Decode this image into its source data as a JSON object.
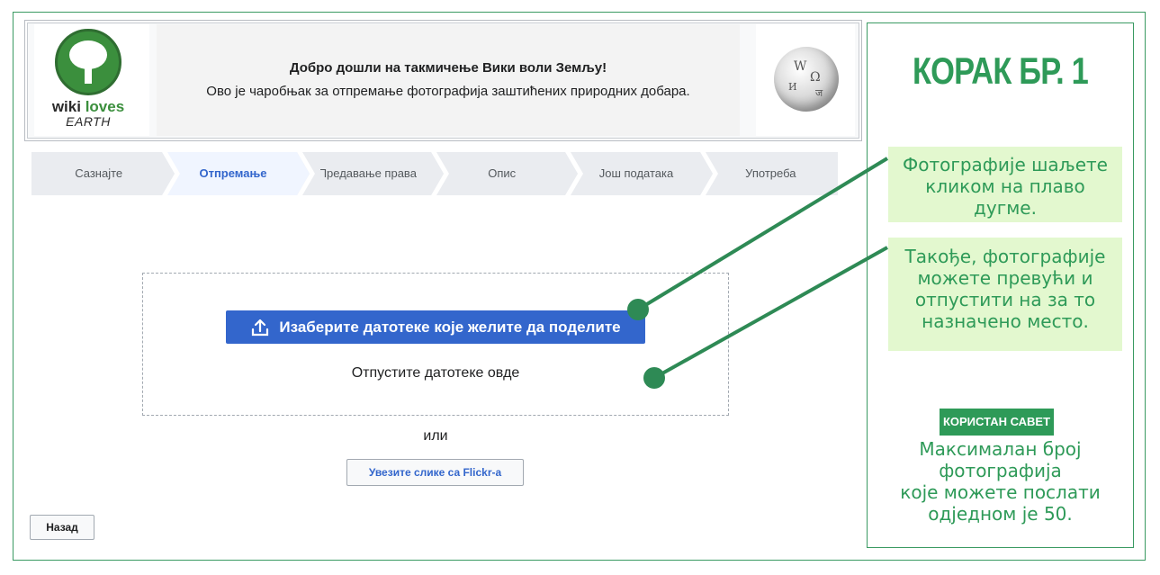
{
  "banner": {
    "logo_word_a": "wiki",
    "logo_word_b": "loves",
    "logo_word_c": "EARTH",
    "title": "Добро дошли на такмичење Вики воли Земљу!",
    "subtitle": "Ово је чаробњак за отпремање фотографија заштићених природних добара."
  },
  "steps": [
    {
      "label": "Сазнајте",
      "active": false
    },
    {
      "label": "Отпремање",
      "active": true
    },
    {
      "label": "Предавање права",
      "active": false
    },
    {
      "label": "Опис",
      "active": false
    },
    {
      "label": "Још података",
      "active": false
    },
    {
      "label": "Употреба",
      "active": false
    }
  ],
  "upload": {
    "button_label": "Изаберите датотеке које желите да поделите",
    "drop_text": "Отпустите датотеке овде",
    "or_text": "или",
    "flickr_button": "Увезите слике са Flickr-а"
  },
  "back_button": "Назад",
  "tutorial": {
    "step_title": "КОРАК БР. 1",
    "callout1": [
      "Фотографије шаљете",
      "кликом на плаво",
      "дугме."
    ],
    "callout2": [
      "Такође, фотографије",
      "можете превући и",
      "отпустити на за то",
      "назначено место."
    ],
    "tip_badge": "КОРИСТАН САВЕТ",
    "tip_lines": [
      "Максималан број",
      "фотографија",
      "које можете послати",
      "одједном је 50."
    ]
  },
  "colors": {
    "accent_blue": "#3366cc",
    "tutorial_green": "#2e9a58",
    "callout_bg": "#e3f8cf"
  }
}
